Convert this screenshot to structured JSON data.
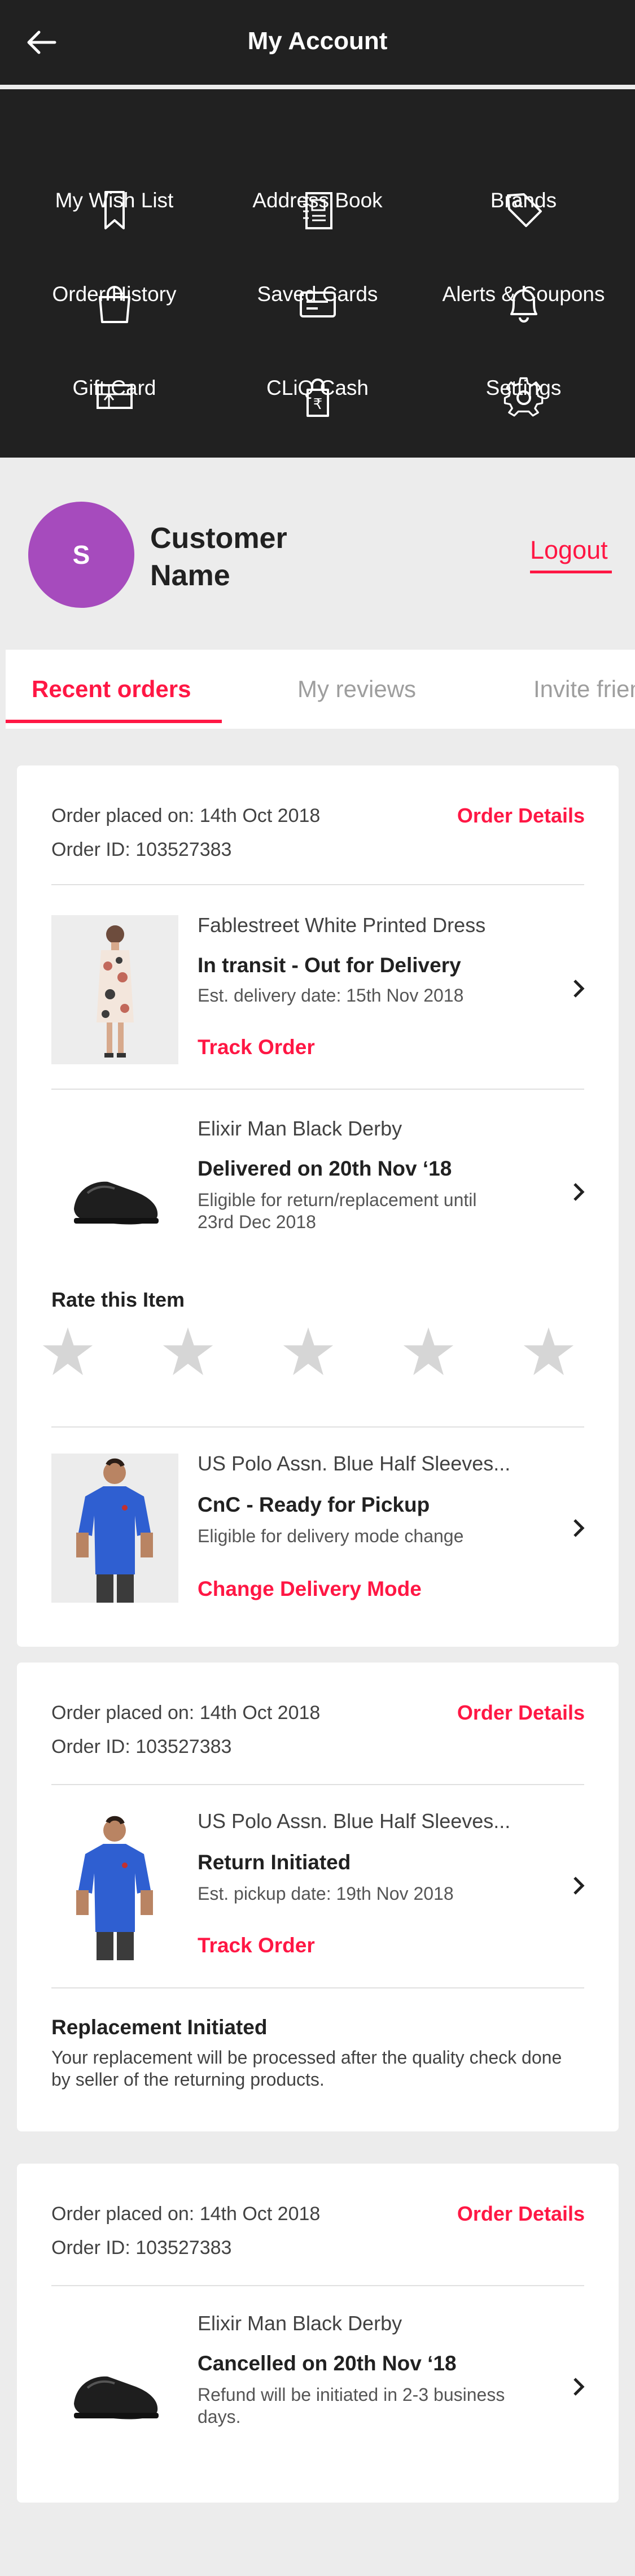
{
  "header": {
    "title": "My Account"
  },
  "menu": [
    {
      "label": "My Wish List",
      "icon": "bookmark-icon"
    },
    {
      "label": "Address Book",
      "icon": "address-book-icon"
    },
    {
      "label": "Brands",
      "icon": "tag-icon"
    },
    {
      "label": "Order History",
      "icon": "shopping-bag-icon"
    },
    {
      "label": "Saved Cards",
      "icon": "credit-card-icon"
    },
    {
      "label": "Alerts & Coupons",
      "icon": "bell-icon"
    },
    {
      "label": "Gift Card",
      "icon": "gift-card-icon"
    },
    {
      "label": "CLiQ Cash",
      "icon": "rupee-bag-icon"
    },
    {
      "label": "Settings",
      "icon": "gear-icon"
    }
  ],
  "profile": {
    "initial": "S",
    "name": "Customer Name",
    "logout": "Logout"
  },
  "tabs": [
    "Recent orders",
    "My reviews",
    "Invite friends"
  ],
  "colors": {
    "accent": "#ff1744",
    "dark": "#212121",
    "avatar": "#a64bbd",
    "star": "#d6d6d6"
  },
  "orders": [
    {
      "placed": "Order placed on: 14th Oct 2018",
      "id": "Order ID: 103527383",
      "details": "Order Details",
      "items": [
        {
          "name": "Fablestreet White Printed Dress",
          "status": "In transit - Out for Delivery",
          "note": "Est. delivery date: 15th Nov 2018",
          "action": "Track Order"
        },
        {
          "name": "Elixir Man Black Derby",
          "status": "Delivered on 20th Nov ‘18",
          "note": "Eligible for return/replacement until 23rd Dec 2018",
          "action": ""
        },
        {
          "name": "US Polo Assn. Blue Half Sleeves...",
          "status": "CnC - Ready for Pickup",
          "note": "Eligible for delivery mode change",
          "action": "Change Delivery Mode"
        }
      ],
      "rate_label": "Rate this Item",
      "rating": 0
    },
    {
      "placed": "Order placed on: 14th Oct 2018",
      "id": "Order ID: 103527383",
      "details": "Order Details",
      "items": [
        {
          "name": "US Polo Assn. Blue Half Sleeves...",
          "status": "Return Initiated",
          "note": "Est. pickup date: 19th Nov 2018",
          "action": "Track Order"
        }
      ],
      "replacement_title": "Replacement Initiated",
      "replacement_note": "Your replacement will be processed after the quality check done by seller of the returning products."
    },
    {
      "placed": "Order placed on: 14th Oct 2018",
      "id": "Order ID: 103527383",
      "details": "Order Details",
      "items": [
        {
          "name": "Elixir Man Black Derby",
          "status": "Cancelled on 20th Nov ‘18",
          "note": "Refund will be initiated in 2-3 business days.",
          "action": ""
        }
      ]
    }
  ]
}
